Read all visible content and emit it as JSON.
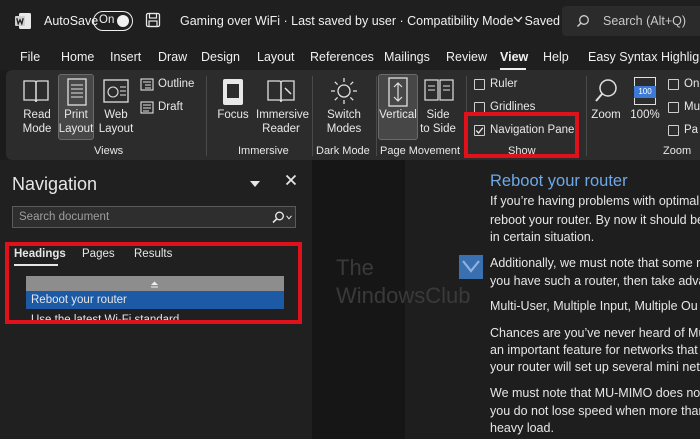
{
  "titlebar": {
    "autosave_label": "AutoSave",
    "toggle_state": "On",
    "document_title": "Gaming over WiFi  ·  Last saved by user  ·  Compatibility Mode  ·  Saved",
    "search_placeholder": "Search (Alt+Q)"
  },
  "menu": {
    "tabs": [
      "File",
      "Home",
      "Insert",
      "Draw",
      "Design",
      "Layout",
      "References",
      "Mailings",
      "Review",
      "View",
      "Help",
      "Easy Syntax Highlighte"
    ],
    "active": "View"
  },
  "ribbon": {
    "views": {
      "read_mode": [
        "Read",
        "Mode"
      ],
      "print_layout": [
        "Print",
        "Layout"
      ],
      "web_layout": [
        "Web",
        "Layout"
      ],
      "outline": "Outline",
      "draft": "Draft",
      "group_label": "Views"
    },
    "immersive": {
      "focus": "Focus",
      "immersive_reader": [
        "Immersive",
        "Reader"
      ],
      "group_label": "Immersive"
    },
    "dark_mode": {
      "switch_modes": [
        "Switch",
        "Modes"
      ],
      "group_label": "Dark Mode"
    },
    "page_movement": {
      "vertical": "Vertical",
      "side_to_side": [
        "Side",
        "to Side"
      ],
      "group_label": "Page Movement"
    },
    "show": {
      "ruler": "Ruler",
      "gridlines": "Gridlines",
      "navigation_pane": "Navigation Pane",
      "ruler_checked": false,
      "gridlines_checked": false,
      "navigation_pane_checked": true,
      "group_label": "Show"
    },
    "zoom": {
      "zoom": "Zoom",
      "percent": "100%",
      "icon_text": "100",
      "group_label": "Zoom",
      "cut_items": [
        "On",
        "Mu",
        "Pa"
      ]
    }
  },
  "navigation": {
    "title": "Navigation",
    "search_placeholder": "Search document",
    "tabs": [
      "Headings",
      "Pages",
      "Results"
    ],
    "active_tab": "Headings",
    "headings": [
      {
        "label": "Reboot your router",
        "selected": true
      },
      {
        "label": "Use the latest Wi-Fi standard",
        "selected": false
      }
    ]
  },
  "document": {
    "heading": "Reboot your router",
    "lines": [
      "If you’re having problems with optimal",
      "reboot your router. By now it should be",
      "in certain situation.",
      "Additionally, we must note that some r",
      "you have such a router, then take advan",
      "Multi-User, Multiple Input, Multiple Ou",
      "Chances are you’ve never heard of Mul",
      "an important feature for networks that",
      "your router will set up several mini netv",
      "We must note that MU-MIMO does not",
      "you do not lose speed when more than",
      "heavy load."
    ]
  },
  "watermark": {
    "line1": "The",
    "line2": "WindowsClub"
  },
  "colors": {
    "highlight_red": "#e0111b",
    "selection_blue": "#1c5aa6",
    "heading_blue": "#6ea8e8"
  }
}
